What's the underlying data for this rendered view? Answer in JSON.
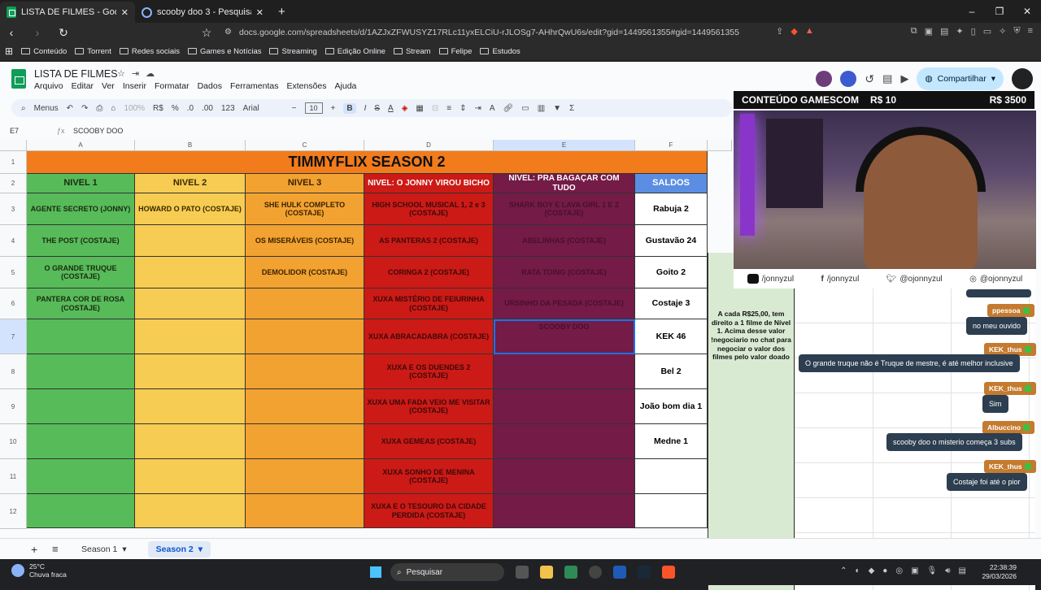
{
  "browser": {
    "tabs": [
      {
        "label": "LISTA DE FILMES - Google Planil",
        "active": true
      },
      {
        "label": "scooby doo 3 - Pesquisa Google",
        "active": false
      }
    ],
    "url": "docs.google.com/spreadsheets/d/1AZJxZFWUSYZ17RLc11yxELCiU-rJLOSg7-AHhrQwU6s/edit?gid=1449561355#gid=1449561355",
    "bookmarks": [
      "Conteúdo",
      "Torrent",
      "Redes sociais",
      "Games e Notícias",
      "Streaming",
      "Edição Online",
      "Stream",
      "Felipe",
      "Estudos"
    ]
  },
  "sheet": {
    "doc_title": "LISTA DE FILMES",
    "menus": [
      "Arquivo",
      "Editar",
      "Ver",
      "Inserir",
      "Formatar",
      "Dados",
      "Ferramentas",
      "Extensões",
      "Ajuda"
    ],
    "toolbar": {
      "menus_label": "Menus",
      "zoom": "100%",
      "currency": "R$",
      "percent": "%",
      "dec_less": ".0",
      "dec_more": ".00",
      "num": "123",
      "font": "Arial",
      "font_size": "10"
    },
    "cell_ref": "E7",
    "formula": "SCOOBY DOO",
    "share_label": "Compartilhar",
    "columns": [
      "A",
      "B",
      "C",
      "D",
      "E",
      "F"
    ],
    "rows": [
      "1",
      "2",
      "3",
      "4",
      "5",
      "6",
      "7",
      "8",
      "9",
      "10",
      "11",
      "12"
    ],
    "title": "TIMMYFLIX SEASON 2",
    "headers": [
      "NIVEL 1",
      "NIVEL 2",
      "NIVEL 3",
      "NIVEL: O JONNY VIROU BICHO",
      "NÍVEL: PRA BAGAÇAR COM TUDO",
      "SALDOS"
    ],
    "data": [
      [
        "AGENTE SECRETO (JONNY)",
        "HOWARD O PATO (COSTAJE)",
        "SHE HULK COMPLETO (COSTAJE)",
        "HIGH SCHOOL MUSICAL 1, 2 e 3 (COSTAJE)",
        "SHARK BOY E LAVA GIRL 1 E 2 (COSTAJE)",
        "Rabuja 2"
      ],
      [
        "THE POST (COSTAJE)",
        "",
        "OS MISERÁVEIS (COSTAJE)",
        "AS PANTERAS 2 (COSTAJE)",
        "ABELINHAS (COSTAJE)",
        "Gustavão 24"
      ],
      [
        "O GRANDE TRUQUE (COSTAJE)",
        "",
        "DEMOLIDOR (COSTAJE)",
        "CORINGA 2 (COSTAJE)",
        "RATA TOING (COSTAJE)",
        "Goito 2"
      ],
      [
        "PANTERA COR DE ROSA (COSTAJE)",
        "",
        "",
        "XUXA MISTÉRIO DE FEIURINHA (COSTAJE)",
        "URSINHO DA PESADA (COSTAJE)",
        "Costaje 3"
      ],
      [
        "",
        "",
        "",
        "XUXA ABRACADABRA (COSTAJE)",
        "SCOOBY DOO",
        "KEK 46"
      ],
      [
        "",
        "",
        "",
        "XUXA E OS DUENDES 2 (COSTAJE)",
        "",
        "Bel 2"
      ],
      [
        "",
        "",
        "",
        "XUXA UMA FADA VEIO ME VISITAR (COSTAJE)",
        "",
        "João bom dia 1"
      ],
      [
        "",
        "",
        "",
        "XUXA GEMEAS (COSTAJE)",
        "",
        "Medne 1"
      ],
      [
        "",
        "",
        "",
        "XUXA SONHO DE MENINA (COSTAJE)",
        "",
        ""
      ],
      [
        "",
        "",
        "",
        "XUXA E O TESOURO DA CIDADE PERDIDA (COSTAJE)",
        "",
        ""
      ]
    ],
    "info_note": "A cada R$25,00, tem direito a 1 filme de Nível 1. Acima desse valor !negociario no chat para negociar o valor dos filmes pelo valor doado",
    "sheet_tabs": [
      "Season 1",
      "Season 2"
    ]
  },
  "stream_overlay": {
    "banner_left": "CONTEÚDO GAMESCOM",
    "banner_mid": "R$ 10",
    "banner_right": "R$ 3500",
    "socials": [
      "/jonnyzul",
      "/jonnyzul",
      "@ojonnyzul",
      "@ojonnyzul"
    ]
  },
  "chat": [
    {
      "user": "ppessoa",
      "text": "no meu ouvido"
    },
    {
      "user": "KEK_thus",
      "text": "O grande truque não é Truque de mestre, é até melhor inclusive"
    },
    {
      "user": "KEK_thus",
      "text": "Sim"
    },
    {
      "user": "Albuccino",
      "text": "scooby doo o misterio começa 3 subs"
    },
    {
      "user": "KEK_thus",
      "text": "Costaje foi até o pior"
    }
  ],
  "taskbar": {
    "temp": "25°C",
    "weather": "Chuva fraca",
    "search": "Pesquisar",
    "time": "22:38:39",
    "date": "29/03/2026"
  }
}
